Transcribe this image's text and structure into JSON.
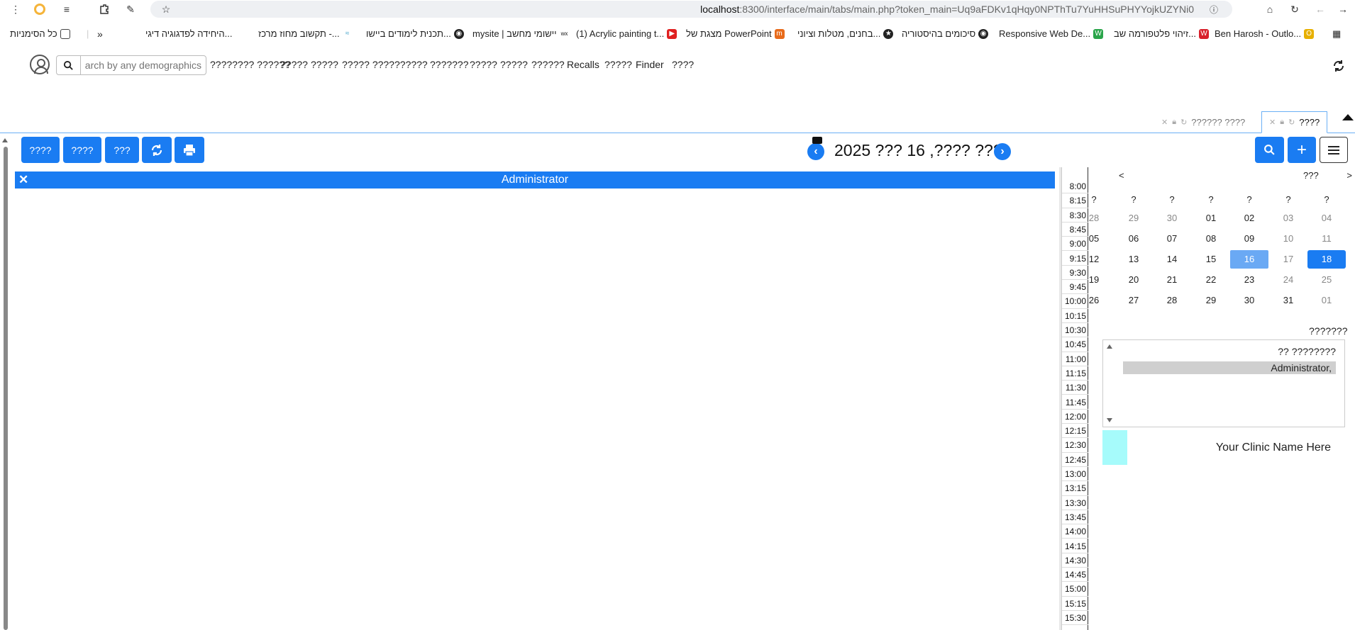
{
  "browser": {
    "url_host": "localhost",
    "url_rest": ":8300/interface/main/tabs/main.php?token_main=Uq9aFDKv1qHqy0NPThTu7YuHHSuPHYYojkUZYNi0",
    "bookmarks": [
      {
        "label": "כל הסימניות",
        "fav_color": "#666",
        "fav": "▭"
      },
      {
        "label": "היחידה לפדגוגיה דיגי...",
        "fav_color": "",
        "fav": ""
      },
      {
        "label": "תקשוב מחוז מרכז -...",
        "fav_color": "#3fa0c8",
        "fav": "≈"
      },
      {
        "label": "תכנית לימודים ביישו...",
        "fav_color": "#222",
        "fav": "◉"
      },
      {
        "label": "mysite | יישומי מחשב",
        "fav_color": "#111",
        "fav": "wx"
      },
      {
        "label": "(1) Acrylic painting t...",
        "fav_color": "#e02020",
        "fav": "▶"
      },
      {
        "label": "מצגת של PowerPoint",
        "fav_color": "#e86b1b",
        "fav": "m"
      },
      {
        "label": "בחנים, מטלות וציוני...",
        "fav_color": "#222",
        "fav": "★"
      },
      {
        "label": "סיכומים בהיסטוריה",
        "fav_color": "#222",
        "fav": "◉"
      },
      {
        "label": "Responsive Web De...",
        "fav_color": "#2aa54a",
        "fav": "W"
      },
      {
        "label": "זיהוי פלטפורמה שב...",
        "fav_color": "#d8202b",
        "fav": "W"
      },
      {
        "label": "Ben Harosh - Outlo...",
        "fav_color": "#e7b000",
        "fav": "O"
      }
    ]
  },
  "nav": {
    "search_placeholder": "Search by any demographics",
    "items": [
      "???????? ??????",
      "?????",
      "?????",
      "????? ????",
      "??????",
      "???????",
      "?????",
      "?????",
      "??????",
      "Recalls",
      "?????",
      "Finder",
      "????"
    ]
  },
  "tabs": [
    {
      "label": "????",
      "active": true
    },
    {
      "label": "?????? ????",
      "active": false
    }
  ],
  "toolbar": {
    "btn1": "????",
    "btn2": "????",
    "btn3": "???",
    "date_title": "2025 ??? 16 ,???? ???"
  },
  "calendar": {
    "provider_header": "Administrator",
    "times": [
      "8:00",
      "8:15",
      "8:30",
      "8:45",
      "9:00",
      "9:15",
      "9:30",
      "9:45",
      "10:00",
      "10:15",
      "10:30",
      "10:45",
      "11:00",
      "11:15",
      "11:30",
      "11:45",
      "12:00",
      "12:15",
      "12:30",
      "12:45",
      "13:00",
      "13:15",
      "13:30",
      "13:45",
      "14:00",
      "14:15",
      "14:30",
      "14:45",
      "15:00",
      "15:15",
      "15:30"
    ]
  },
  "mini_calendar": {
    "prev": "<",
    "next": ">",
    "month_label": "???",
    "weekday_headers": [
      "?",
      "?",
      "?",
      "?",
      "?",
      "?",
      "?"
    ],
    "weeks": [
      [
        "04",
        "03",
        "02",
        "01",
        "30",
        "29",
        "28"
      ],
      [
        "11",
        "10",
        "09",
        "08",
        "07",
        "06",
        "05"
      ],
      [
        "18",
        "17",
        "16",
        "15",
        "14",
        "13",
        "12"
      ],
      [
        "25",
        "24",
        "23",
        "22",
        "21",
        "20",
        "19"
      ],
      [
        "01",
        "31",
        "30",
        "29",
        "28",
        "27",
        "26"
      ]
    ],
    "today": "18",
    "selected": "16"
  },
  "providers": {
    "label": "???????",
    "options": [
      "?? ????????",
      "Administrator,"
    ],
    "selected": "Administrator,"
  },
  "facility": {
    "name": "Your Clinic Name Here",
    "color": "#a6fbfb"
  },
  "colors": {
    "accent": "#1a7cf2"
  }
}
